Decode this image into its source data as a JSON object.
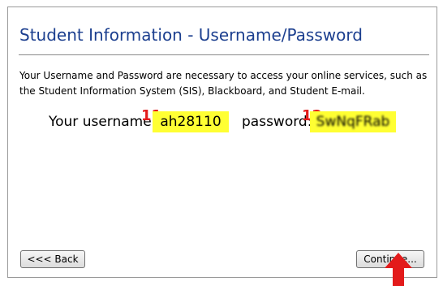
{
  "page": {
    "title": "Student Information - Username/Password",
    "description": "Your Username and Password are necessary to access your online services, such as the Student Information System (SIS), Blackboard, and Student E-mail."
  },
  "credentials": {
    "username_label": "Your username:",
    "username_value": "ah28110",
    "username_marker": "11",
    "password_label": "password:",
    "password_value": "SwNqFRab",
    "password_marker": "12",
    "highlight_color": "#ffff33",
    "marker_color": "#e31b1b"
  },
  "buttons": {
    "back_label": "<<< Back",
    "continue_label": "Continue..."
  },
  "annotations": {
    "pointer": "red-up-arrow-icon"
  }
}
